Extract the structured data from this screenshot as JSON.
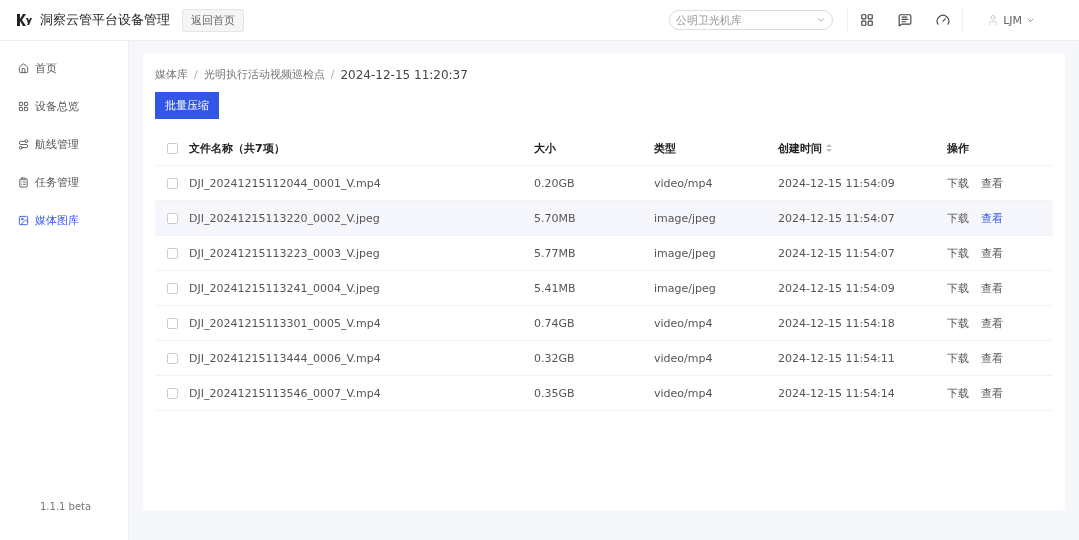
{
  "header": {
    "title": "洞察云管平台设备管理",
    "back_button": "返回首页",
    "dock_select": {
      "value": "公明卫光机库"
    },
    "user": "LJM"
  },
  "sidebar": {
    "items": [
      {
        "label": "首页",
        "selected": false
      },
      {
        "label": "设备总览",
        "selected": false
      },
      {
        "label": "航线管理",
        "selected": false
      },
      {
        "label": "任务管理",
        "selected": false
      },
      {
        "label": "媒体图库",
        "selected": true
      }
    ],
    "version": "1.1.1 beta"
  },
  "breadcrumb": [
    "媒体库",
    "光明执行活动视频巡检点",
    "2024-12-15 11:20:37"
  ],
  "breadcrumb_separator": "/",
  "select_all_checked": false,
  "batch_button": "批量压缩",
  "table": {
    "columns": [
      "文件名称（共7项）",
      "大小",
      "类型",
      "创建时间",
      "操作"
    ],
    "rows": [
      {
        "name": "DJI_20241215112044_0001_V.mp4",
        "size": "0.20GB",
        "type": "video/mp4",
        "created": "2024-12-15 11:54:09",
        "actions": [
          "下载",
          "查看"
        ],
        "hovered": false,
        "checked": false
      },
      {
        "name": "DJI_20241215113220_0002_V.jpeg",
        "size": "5.70MB",
        "type": "image/jpeg",
        "created": "2024-12-15 11:54:07",
        "actions": [
          "下载",
          "查看"
        ],
        "hovered": true,
        "checked": false
      },
      {
        "name": "DJI_20241215113223_0003_V.jpeg",
        "size": "5.77MB",
        "type": "image/jpeg",
        "created": "2024-12-15 11:54:07",
        "actions": [
          "下载",
          "查看"
        ],
        "hovered": false,
        "checked": false
      },
      {
        "name": "DJI_20241215113241_0004_V.jpeg",
        "size": "5.41MB",
        "type": "image/jpeg",
        "created": "2024-12-15 11:54:09",
        "actions": [
          "下载",
          "查看"
        ],
        "hovered": false,
        "checked": false
      },
      {
        "name": "DJI_20241215113301_0005_V.mp4",
        "size": "0.74GB",
        "type": "video/mp4",
        "created": "2024-12-15 11:54:18",
        "actions": [
          "下载",
          "查看"
        ],
        "hovered": false,
        "checked": false
      },
      {
        "name": "DJI_20241215113444_0006_V.mp4",
        "size": "0.32GB",
        "type": "video/mp4",
        "created": "2024-12-15 11:54:11",
        "actions": [
          "下载",
          "查看"
        ],
        "hovered": false,
        "checked": false
      },
      {
        "name": "DJI_20241215113546_0007_V.mp4",
        "size": "0.35GB",
        "type": "video/mp4",
        "created": "2024-12-15 11:54:14",
        "actions": [
          "下载",
          "查看"
        ],
        "hovered": false,
        "checked": false
      }
    ]
  }
}
